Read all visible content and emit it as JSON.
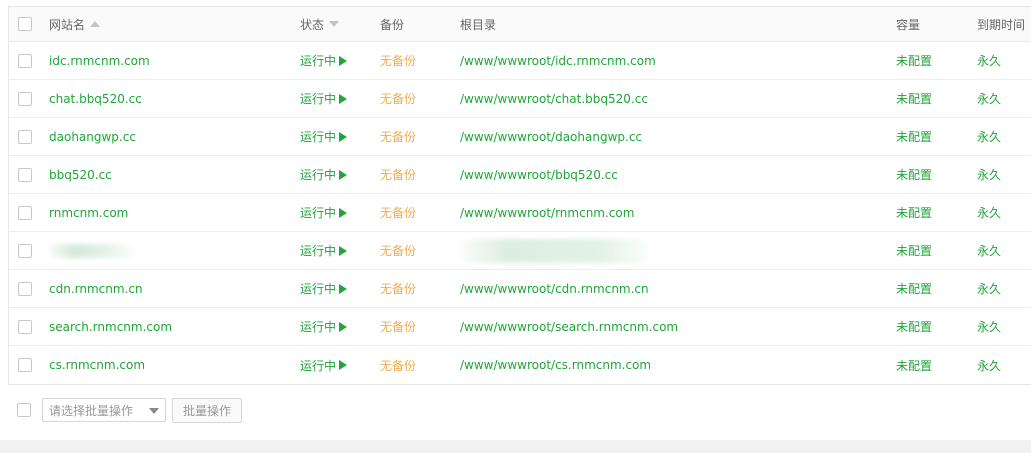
{
  "table": {
    "headers": {
      "name": "网站名",
      "status": "状态",
      "backup": "备份",
      "path": "根目录",
      "quota": "容量",
      "expire": "到期时间"
    },
    "rows": [
      {
        "name": "idc.rnmcnm.com",
        "status": "运行中",
        "backup": "无备份",
        "path": "/www/wwwroot/idc.rnmcnm.com",
        "quota": "未配置",
        "expire": "永久"
      },
      {
        "name": "chat.bbq520.cc",
        "status": "运行中",
        "backup": "无备份",
        "path": "/www/wwwroot/chat.bbq520.cc",
        "quota": "未配置",
        "expire": "永久"
      },
      {
        "name": "daohangwp.cc",
        "status": "运行中",
        "backup": "无备份",
        "path": "/www/wwwroot/daohangwp.cc",
        "quota": "未配置",
        "expire": "永久"
      },
      {
        "name": "bbq520.cc",
        "status": "运行中",
        "backup": "无备份",
        "path": "/www/wwwroot/bbq520.cc",
        "quota": "未配置",
        "expire": "永久"
      },
      {
        "name": "rnmcnm.com",
        "status": "运行中",
        "backup": "无备份",
        "path": "/www/wwwroot/rnmcnm.com",
        "quota": "未配置",
        "expire": "永久"
      },
      {
        "name": "",
        "status": "运行中",
        "backup": "无备份",
        "path": "",
        "quota": "未配置",
        "expire": "永久"
      },
      {
        "name": "cdn.rnmcnm.cn",
        "status": "运行中",
        "backup": "无备份",
        "path": "/www/wwwroot/cdn.rnmcnm.cn",
        "quota": "未配置",
        "expire": "永久"
      },
      {
        "name": "search.rnmcnm.com",
        "status": "运行中",
        "backup": "无备份",
        "path": "/www/wwwroot/search.rnmcnm.com",
        "quota": "未配置",
        "expire": "永久"
      },
      {
        "name": "cs.rnmcnm.com",
        "status": "运行中",
        "backup": "无备份",
        "path": "/www/wwwroot/cs.rnmcnm.com",
        "quota": "未配置",
        "expire": "永久"
      }
    ]
  },
  "footer": {
    "batch_select_placeholder": "请选择批量操作",
    "batch_button_label": "批量操作"
  },
  "colors": {
    "accent": "#20a53a",
    "warning": "#f0ad4e"
  }
}
